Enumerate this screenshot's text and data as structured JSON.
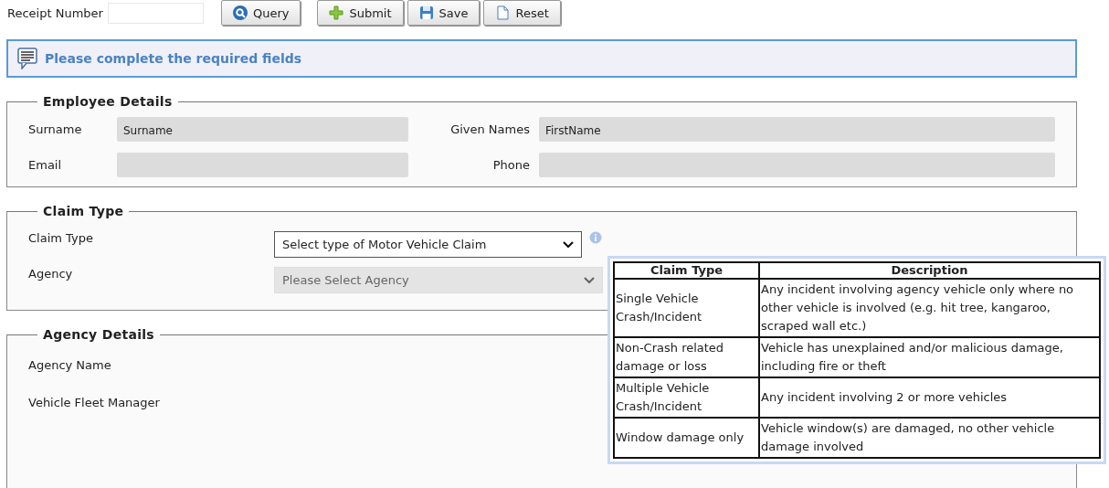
{
  "toolbar": {
    "receipt_label": "Receipt Number",
    "buttons": [
      {
        "label": "Query"
      },
      {
        "label": "Submit"
      },
      {
        "label": "Save"
      },
      {
        "label": "Reset"
      }
    ]
  },
  "message": "Please complete the required fields",
  "employee": {
    "title": "Employee Details",
    "fields": [
      {
        "label": "Surname",
        "value": "Surname",
        "disabled": true
      },
      {
        "label": "Given Names",
        "value": "FirstName",
        "disabled": true
      },
      {
        "label": "Email",
        "disabled": true
      },
      {
        "label": "Phone",
        "disabled": true
      }
    ]
  },
  "claim": {
    "title": "Claim Type",
    "selects": [
      {
        "label": "Claim Type",
        "value": "Select type of Motor Vehicle Claim",
        "disabled": false
      },
      {
        "label": "Agency",
        "value": "Please Select Agency",
        "disabled": true
      }
    ]
  },
  "agency": {
    "title": "Agency Details",
    "labels": [
      "Agency Name",
      "Vehicle Fleet Manager"
    ]
  },
  "tooltip": {
    "columns": [
      "Claim Type",
      "Description"
    ],
    "rows": [
      [
        "Single Vehicle Crash/Incident",
        "Any incident involving agency vehicle only where no other vehicle is involved (e.g.  hit tree, kangaroo, scraped wall etc.)"
      ],
      [
        "Non-Crash related damage or loss",
        "Vehicle has unexplained and/or malicious damage, including fire or theft"
      ],
      [
        "Multiple Vehicle Crash/Incident",
        "Any incident involving 2 or more vehicles"
      ],
      [
        "Window damage only",
        "Vehicle window(s) are damaged, no other vehicle damage involved"
      ]
    ]
  }
}
